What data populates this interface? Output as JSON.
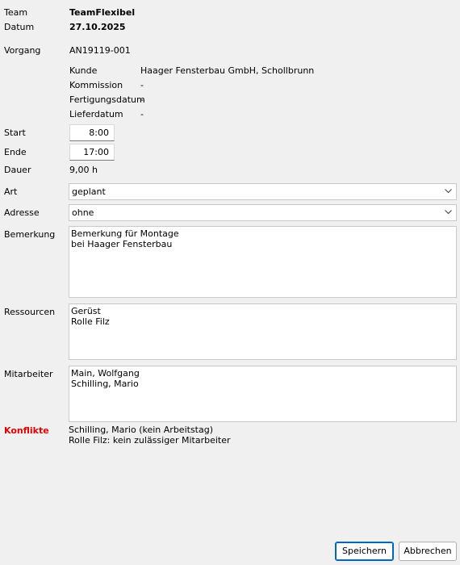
{
  "labels": {
    "team": "Team",
    "datum": "Datum",
    "vorgang": "Vorgang",
    "kunde": "Kunde",
    "kommission": "Kommission",
    "fertigungsdatum": "Fertigungsdatum",
    "lieferdatum": "Lieferdatum",
    "start": "Start",
    "ende": "Ende",
    "dauer": "Dauer",
    "art": "Art",
    "adresse": "Adresse",
    "bemerkung": "Bemerkung",
    "ressourcen": "Ressourcen",
    "mitarbeiter": "Mitarbeiter",
    "konflikte": "Konflikte"
  },
  "values": {
    "team": "TeamFlexibel",
    "datum": "27.10.2025",
    "vorgang": "AN19119-001",
    "kunde": "Haager Fensterbau GmbH, Schollbrunn",
    "kommission": "-",
    "fertigungsdatum": "-",
    "lieferdatum": "-",
    "start": "8:00",
    "ende": "17:00",
    "dauer": "9,00 h",
    "art": "geplant",
    "adresse": "ohne",
    "bemerkung": "Bemerkung für Montage\nbei Haager Fensterbau",
    "ressourcen": "Gerüst\nRolle Filz",
    "mitarbeiter": "Main, Wolfgang\nSchilling, Mario",
    "konflikte": "Schilling, Mario (kein Arbeitstag)\nRolle Filz: kein zulässiger Mitarbeiter"
  },
  "buttons": {
    "speichern": "Speichern",
    "abbrechen": "Abbrechen"
  },
  "colors": {
    "conflict": "#e60000",
    "primary_border": "#0067c0"
  }
}
